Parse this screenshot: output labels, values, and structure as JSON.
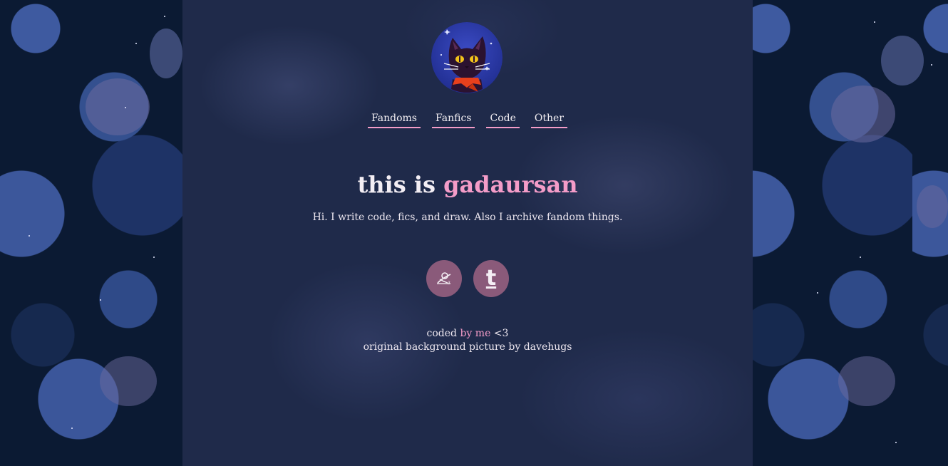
{
  "nav": {
    "items": [
      {
        "label": "Fandoms"
      },
      {
        "label": "Fanfics"
      },
      {
        "label": "Code"
      },
      {
        "label": "Other"
      }
    ]
  },
  "hero": {
    "title_prefix": "this is",
    "title_name": "gadaursan",
    "tagline": "Hi. I write code, fics, and draw. Also I archive fandom things."
  },
  "socials": [
    {
      "icon": "ao3-icon"
    },
    {
      "icon": "tumblr-icon",
      "glyph": "t"
    }
  ],
  "footer": {
    "coded": "coded",
    "by_me": "by me",
    "heart": "<3",
    "credit": "original background picture by davehugs"
  },
  "colors": {
    "accent": "#f49cc8",
    "panel": "#1f2a4a",
    "social_bg": "#8a5a7a"
  }
}
